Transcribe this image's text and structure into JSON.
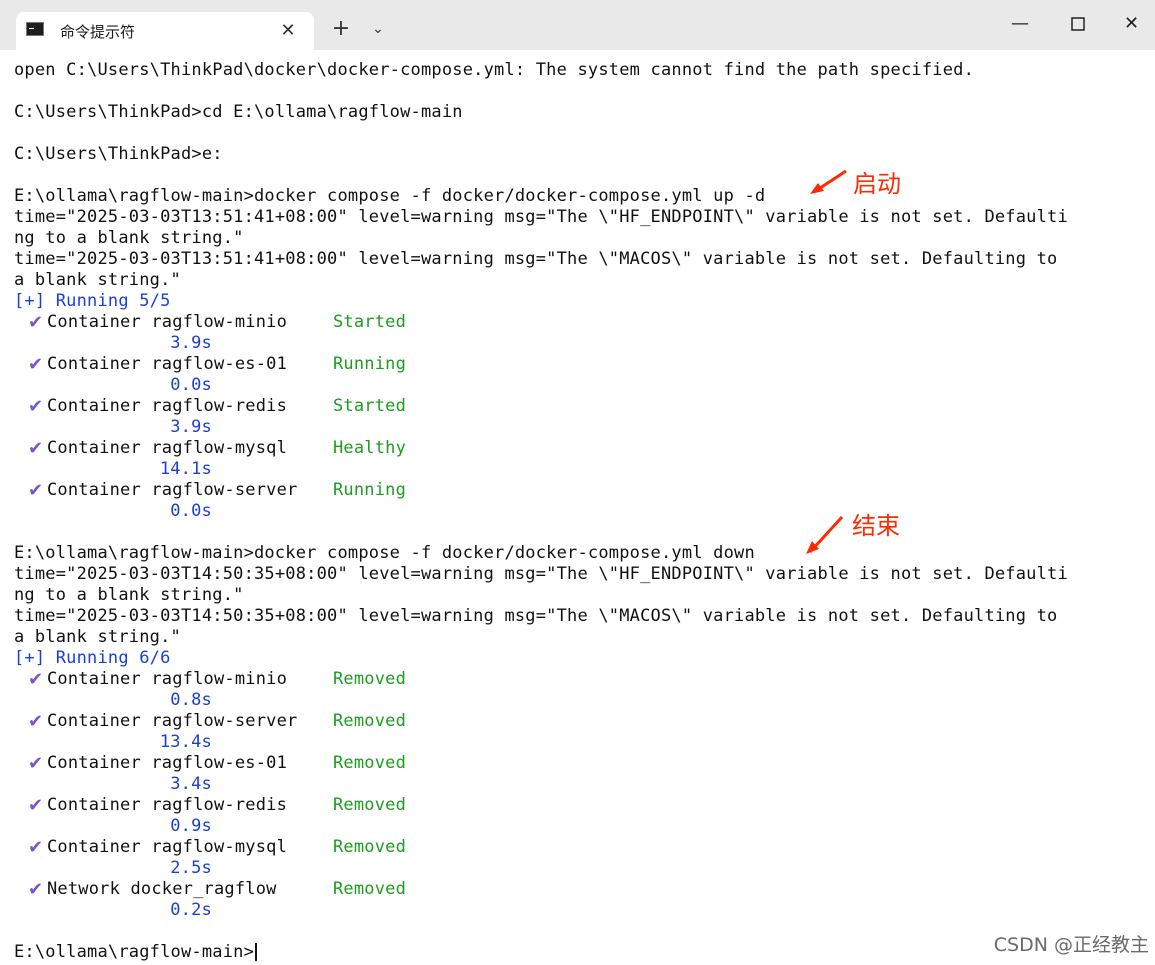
{
  "window": {
    "tab_title": "命令提示符",
    "tab_close_icon": "close-icon",
    "new_tab_label": "+",
    "dropdown_icon": "chevron-down-icon",
    "minimize_icon": "minimize-icon",
    "maximize_icon": "maximize-icon",
    "close_icon": "close-icon"
  },
  "terminal": {
    "lines": [
      "open C:\\Users\\ThinkPad\\docker\\docker-compose.yml: The system cannot find the path specified.",
      "",
      "C:\\Users\\ThinkPad>cd E:\\ollama\\ragflow-main",
      "",
      "C:\\Users\\ThinkPad>e:",
      "",
      "E:\\ollama\\ragflow-main>docker compose -f docker/docker-compose.yml up -d",
      "time=\"2025-03-03T13:51:41+08:00\" level=warning msg=\"The \\\"HF_ENDPOINT\\\" variable is not set. Defaulti",
      "ng to a blank string.\"",
      "time=\"2025-03-03T13:51:41+08:00\" level=warning msg=\"The \\\"MACOS\\\" variable is not set. Defaulting to",
      "a blank string.\"",
      "[+] Running 5/5",
      "",
      "",
      "",
      "",
      "",
      "",
      "",
      "",
      "",
      "",
      "",
      "E:\\ollama\\ragflow-main>docker compose -f docker/docker-compose.yml down",
      "time=\"2025-03-03T14:50:35+08:00\" level=warning msg=\"The \\\"HF_ENDPOINT\\\" variable is not set. Defaulti",
      "ng to a blank string.\"",
      "time=\"2025-03-03T14:50:35+08:00\" level=warning msg=\"The \\\"MACOS\\\" variable is not set. Defaulting to",
      "a blank string.\"",
      "[+] Running 6/6",
      "",
      "",
      "",
      "",
      "",
      "",
      "",
      "",
      "",
      "",
      "",
      "",
      "",
      "E:\\ollama\\ragflow-main>"
    ],
    "up_containers": [
      {
        "name": "Container ragflow-minio",
        "status": "Started",
        "time": "3.9s"
      },
      {
        "name": "Container ragflow-es-01",
        "status": "Running",
        "time": "0.0s"
      },
      {
        "name": "Container ragflow-redis",
        "status": "Started",
        "time": "3.9s"
      },
      {
        "name": "Container ragflow-mysql",
        "status": "Healthy",
        "time": "14.1s"
      },
      {
        "name": "Container ragflow-server",
        "status": "Running",
        "time": "0.0s"
      }
    ],
    "down_containers": [
      {
        "name": "Container ragflow-minio",
        "status": "Removed",
        "time": "0.8s"
      },
      {
        "name": "Container ragflow-server",
        "status": "Removed",
        "time": "13.4s"
      },
      {
        "name": "Container ragflow-es-01",
        "status": "Removed",
        "time": "3.4s"
      },
      {
        "name": "Container ragflow-redis",
        "status": "Removed",
        "time": "0.9s"
      },
      {
        "name": "Container ragflow-mysql",
        "status": "Removed",
        "time": "2.5s"
      },
      {
        "name": "Network docker_ragflow",
        "status": "Removed",
        "time": "0.2s"
      }
    ]
  },
  "annotations": {
    "start_label": "启动",
    "stop_label": "结束",
    "color": "#ff2a00"
  },
  "watermark": "CSDN @正经教主",
  "colors": {
    "status_green": "#1e9c1e",
    "progress_blue": "#1a3fd6",
    "check_purple": "#7a57c8"
  }
}
